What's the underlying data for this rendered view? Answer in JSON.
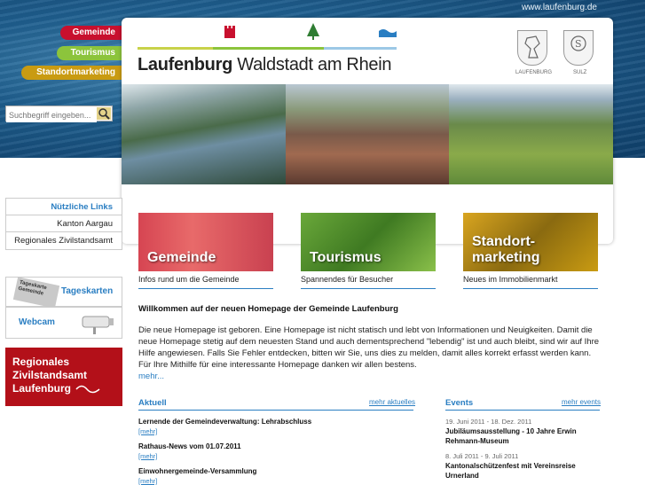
{
  "header": {
    "url": "www.laufenburg.de",
    "title_bold": "Laufenburg",
    "title_rest": " Waldstadt am Rhein",
    "crests": [
      {
        "label": "LAUFENBURG"
      },
      {
        "label": "SULZ"
      }
    ]
  },
  "nav": {
    "gemeinde": "Gemeinde",
    "tourismus": "Tourismus",
    "standortmarketing": "Standortmarketing"
  },
  "search": {
    "placeholder": "Suchbegriff eingeben..."
  },
  "useful_links": {
    "heading": "Nützliche Links",
    "items": [
      "Kanton Aargau",
      "Regionales Zivilstandsamt"
    ]
  },
  "widgets": {
    "tageskarten": "Tageskarten",
    "tageskarte_badge": "Tageskarte Gemeinde",
    "webcam": "Webcam"
  },
  "regionales": {
    "line1": "Regionales",
    "line2": "Zivilstandsamt",
    "line3": "Laufenburg"
  },
  "tiles": [
    {
      "title": "Gemeinde",
      "caption": "Infos rund um die Gemeinde",
      "color": "#c8102e"
    },
    {
      "title": "Tourismus",
      "caption": "Spannendes für Besucher",
      "color": "#5a9a2a"
    },
    {
      "title": "Standort-\nmarketing",
      "caption": "Neues im Immobilienmarkt",
      "color": "#c99b12"
    }
  ],
  "welcome": {
    "heading": "Willkommen auf der neuen Homepage der Gemeinde Laufenburg",
    "text": "Die neue Homepage ist geboren. Eine Homepage ist nicht statisch und lebt von Informationen und Neuigkeiten. Damit die neue Homepage stetig auf dem neuesten Stand und auch dementsprechend \"lebendig\" ist und auch bleibt, sind wir auf Ihre Hilfe angewiesen. Falls Sie Fehler entdecken, bitten wir Sie, uns dies zu melden, damit alles korrekt erfasst werden kann. Für Ihre Mithilfe für eine interessante Homepage danken wir allen bestens.",
    "more": "mehr..."
  },
  "aktuell": {
    "heading": "Aktuell",
    "more": "mehr aktuelles",
    "items": [
      {
        "title": "Lernende der Gemeindeverwaltung: Lehrabschluss",
        "more": "[mehr]"
      },
      {
        "title": "Rathaus-News vom 01.07.2011",
        "more": "[mehr]"
      },
      {
        "title": "Einwohnergemeinde-Versammlung",
        "more": "[mehr]"
      }
    ]
  },
  "events": {
    "heading": "Events",
    "more": "mehr events",
    "items": [
      {
        "date": "19. Juni 2011 - 18. Dez. 2011",
        "title": "Jubiläumsausstellung - 10 Jahre Erwin Rehmann-Museum"
      },
      {
        "date": "8. Juli 2011 - 9. Juli 2011",
        "title": "Kantonalschützenfest mit Vereinsreise Urnerland"
      }
    ]
  },
  "colors": {
    "accent_blue": "#2a7ec2",
    "gemeinde_red": "#c8102e",
    "tourismus_green": "#8cc43c",
    "standort_gold": "#c99b12",
    "regionales_red": "#b31019"
  }
}
